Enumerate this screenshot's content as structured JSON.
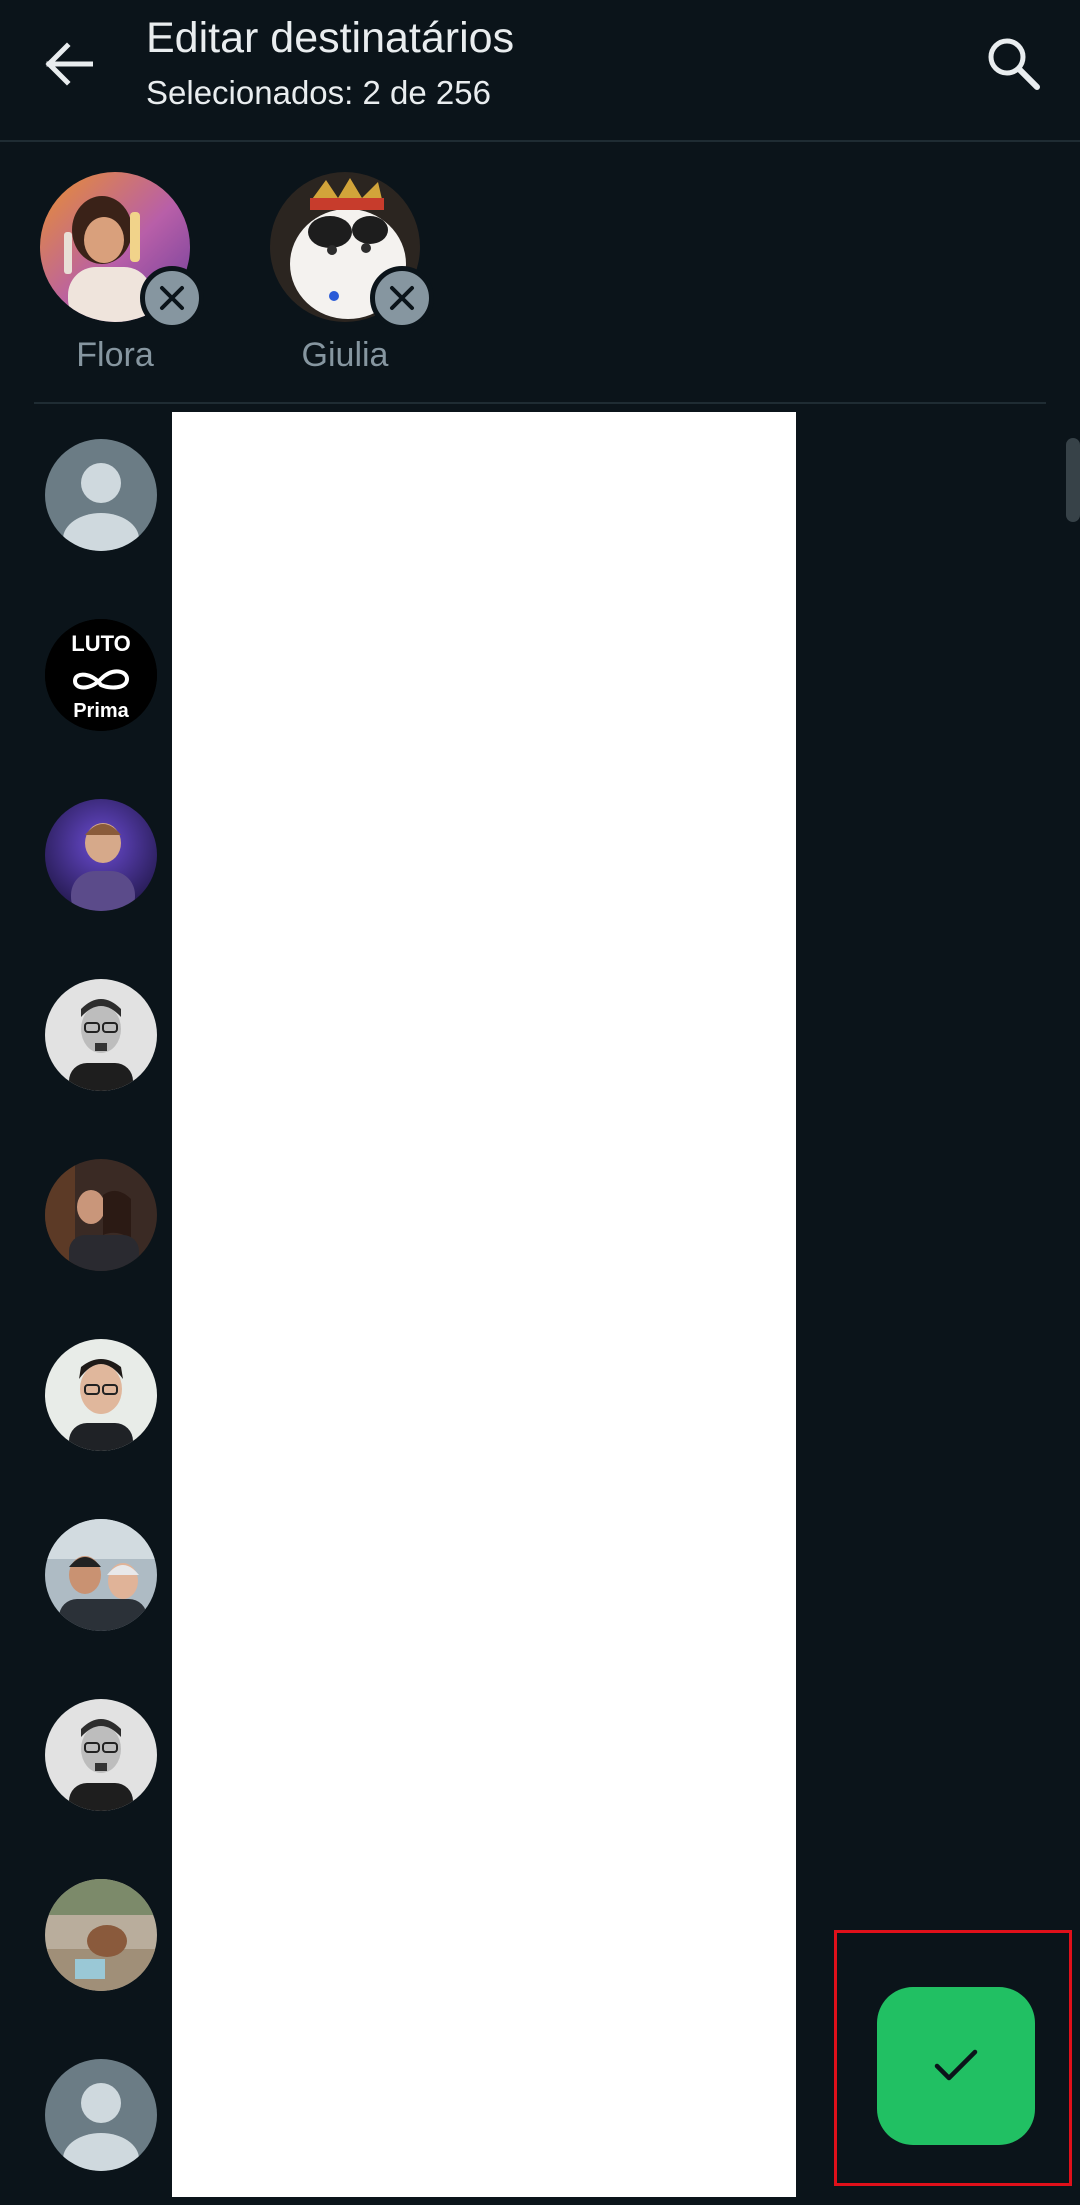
{
  "header": {
    "title": "Editar destinatários",
    "subtitle": "Selecionados: 2 de 256",
    "back_icon": "arrow-left-icon",
    "search_icon": "search-icon"
  },
  "selected": [
    {
      "name": "Flora"
    },
    {
      "name": "Giulia"
    }
  ],
  "contacts": [
    {
      "avatar": "default-avatar"
    },
    {
      "avatar": "luto-prima-logo",
      "logo_line1": "LUTO",
      "logo_line2": "Prima"
    },
    {
      "avatar": "photo"
    },
    {
      "avatar": "photo"
    },
    {
      "avatar": "photo"
    },
    {
      "avatar": "photo"
    },
    {
      "avatar": "photo"
    },
    {
      "avatar": "photo"
    },
    {
      "avatar": "photo"
    },
    {
      "avatar": "default-avatar"
    }
  ],
  "fab": {
    "icon": "checkmark-icon"
  },
  "colors": {
    "background": "#0b141a",
    "accent_green": "#21c063",
    "muted_text": "#8696a0",
    "highlight_red": "#e0101a"
  }
}
